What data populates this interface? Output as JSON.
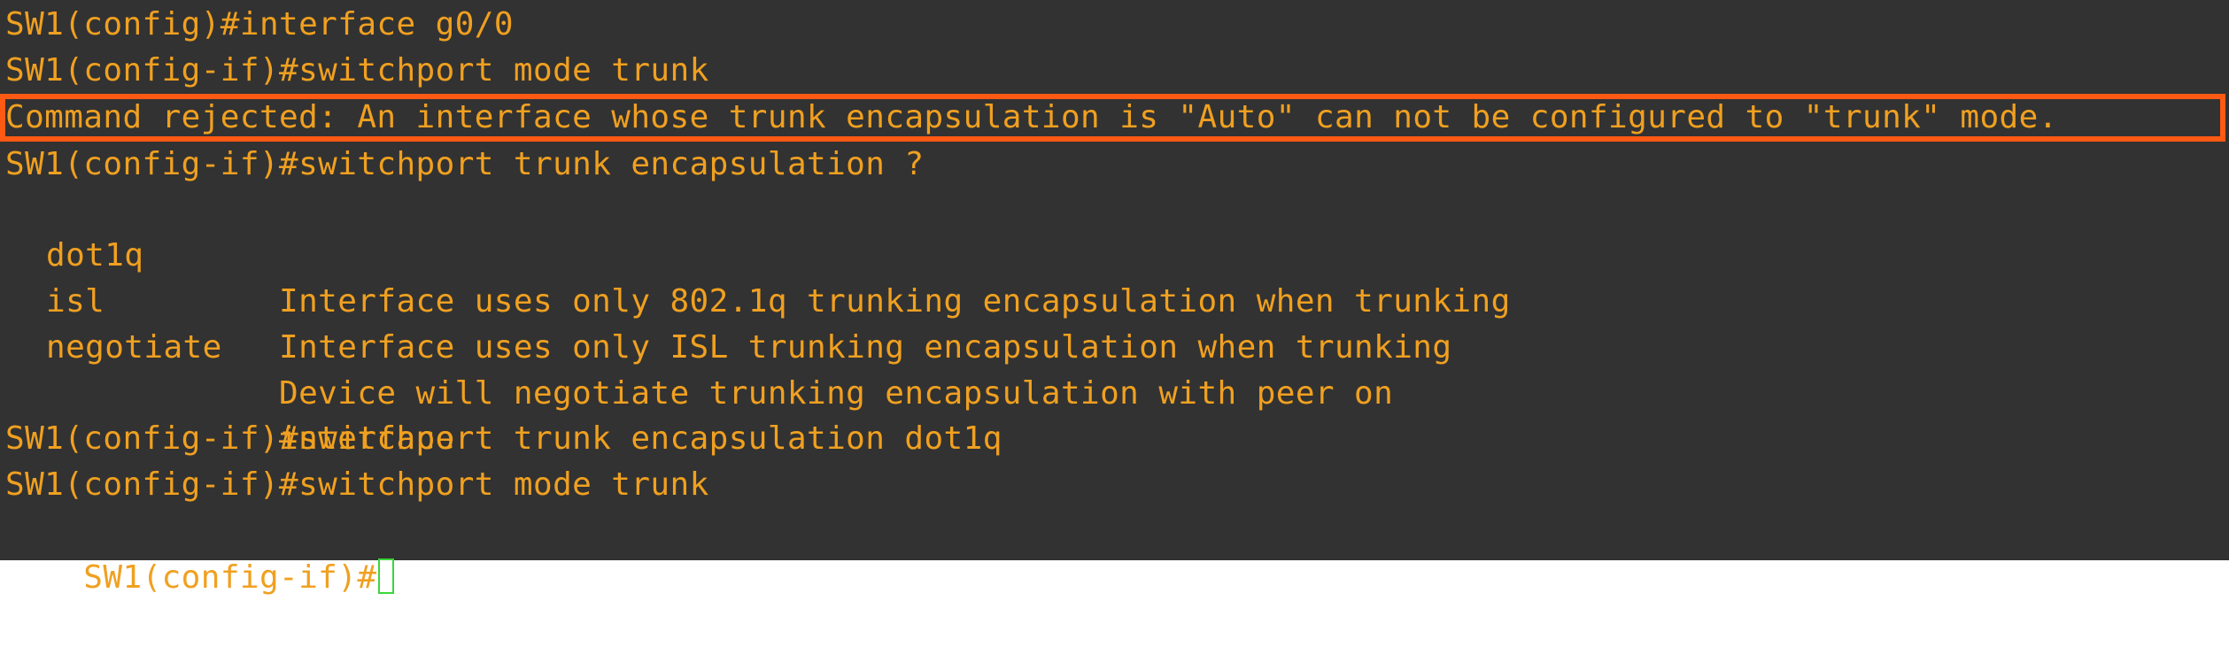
{
  "colors": {
    "background": "#323232",
    "text": "#f0a020",
    "highlight_border": "#ff5a14",
    "cursor": "#3ad63a"
  },
  "terminal": {
    "lines": [
      "SW1(config)#interface g0/0",
      "SW1(config-if)#switchport mode trunk",
      "Command rejected: An interface whose trunk encapsulation is \"Auto\" can not be configured to \"trunk\" mode.",
      "SW1(config-if)#switchport trunk encapsulation ?"
    ],
    "help_rows": [
      {
        "option": "dot1q",
        "description": "Interface uses only 802.1q trunking encapsulation when trunking"
      },
      {
        "option": "isl",
        "description": "Interface uses only ISL trunking encapsulation when trunking"
      },
      {
        "option": "negotiate",
        "description": "Device will negotiate trunking encapsulation with peer on"
      },
      {
        "option": "",
        "description": "interface"
      }
    ],
    "after_lines": [
      "SW1(config-if)#switchport trunk encapsulation dot1q",
      "SW1(config-if)#switchport mode trunk"
    ],
    "prompt": "SW1(config-if)#",
    "cursor_icon": "block-cursor-icon"
  }
}
